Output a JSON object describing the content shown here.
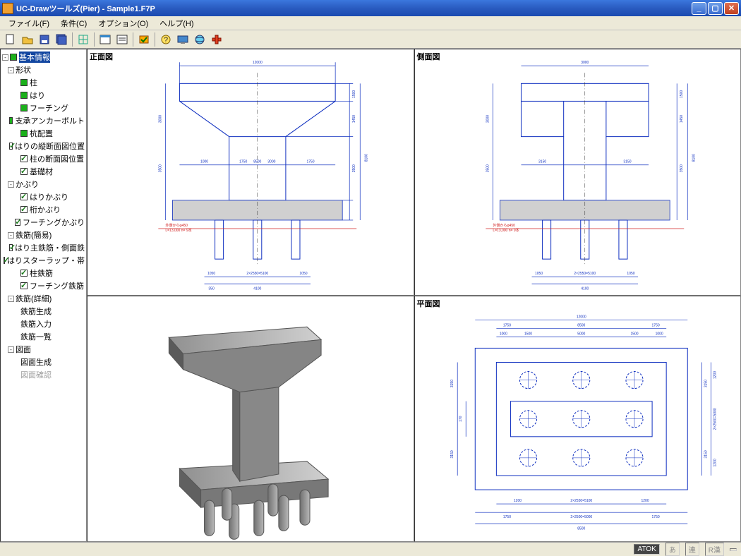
{
  "window": {
    "title": "UC-Drawツールズ(Pier) - Sample1.F7P"
  },
  "menu": {
    "file": "ファイル(F)",
    "cond": "条件(C)",
    "option": "オプション(O)",
    "help": "ヘルプ(H)"
  },
  "tree": {
    "root": "基本情報",
    "group_shape": "形状",
    "shape_items": [
      "柱",
      "はり",
      "フーチング",
      "支承アンカーボルト",
      "杭配置",
      "はりの縦断面図位置",
      "柱の断面図位置",
      "基礎材"
    ],
    "group_cover": "かぶり",
    "cover_items": [
      "はりかぶり",
      "桁かぶり",
      "フーチングかぶり"
    ],
    "group_tekkin_easy": "鉄筋(簡易)",
    "tekkin_easy_items": [
      "はり主鉄筋・側面鉄",
      "はりスターラップ・帯",
      "柱鉄筋",
      "フーチング鉄筋"
    ],
    "group_tekkin_det": "鉄筋(詳細)",
    "tekkin_det_items": [
      "鉄筋生成",
      "鉄筋入力",
      "鉄筋一覧"
    ],
    "group_zumen": "図面",
    "zumen_items": [
      "図面生成",
      "図面確認"
    ]
  },
  "views": {
    "front": "正面図",
    "side": "側面図",
    "plan": "平面図"
  },
  "dims": {
    "top_w": "12000",
    "top_h": "1500",
    "upper_h": "3000",
    "mid_h": "3500",
    "pile_note1": "外側からφ450",
    "pile_note2": "L=13,000 n= 9本",
    "footing_w": "8500",
    "footing_wlbl": "2×2550=5100",
    "plan_w": "12000",
    "plan_inner": "8500",
    "plan_spacing": "5000",
    "plan_side": "1750",
    "plan_margin": "1000",
    "plan_half": "1500",
    "plan_h_outer": "3150",
    "plan_h_in": "1200",
    "plan_mid": "2×2500=5000",
    "s_1000": "1000",
    "s_1750": "1750",
    "s_3000": "3000",
    "s_3150": "3150",
    "s_4100": "4100",
    "s_1050": "1050",
    "s_1200": "1200",
    "s_170": "170",
    "s_350": "350",
    "s_8100": "8100",
    "s_1450": "1450"
  },
  "status": {
    "atok": "ATOK",
    "cells": [
      "あ",
      "連",
      "R漢",
      ""
    ]
  }
}
